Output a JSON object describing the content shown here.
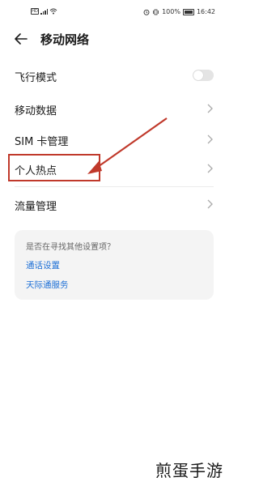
{
  "status_bar": {
    "battery_text": "100%",
    "time": "16:42",
    "sim_label": "HD"
  },
  "header": {
    "title": "移动网络"
  },
  "list": {
    "airplane_mode": {
      "label": "飞行模式",
      "enabled": false
    },
    "mobile_data": {
      "label": "移动数据"
    },
    "sim_management": {
      "label": "SIM 卡管理"
    },
    "personal_hotspot": {
      "label": "个人热点"
    },
    "data_usage": {
      "label": "流量管理"
    }
  },
  "suggestions": {
    "question": "是否在寻找其他设置项？",
    "links": [
      "通话设置",
      "天际通服务"
    ]
  },
  "watermark": "煎蛋手游",
  "colors": {
    "annotation_red": "#c0392b",
    "link_blue": "#1d6fd6",
    "card_bg": "#f4f4f4"
  }
}
